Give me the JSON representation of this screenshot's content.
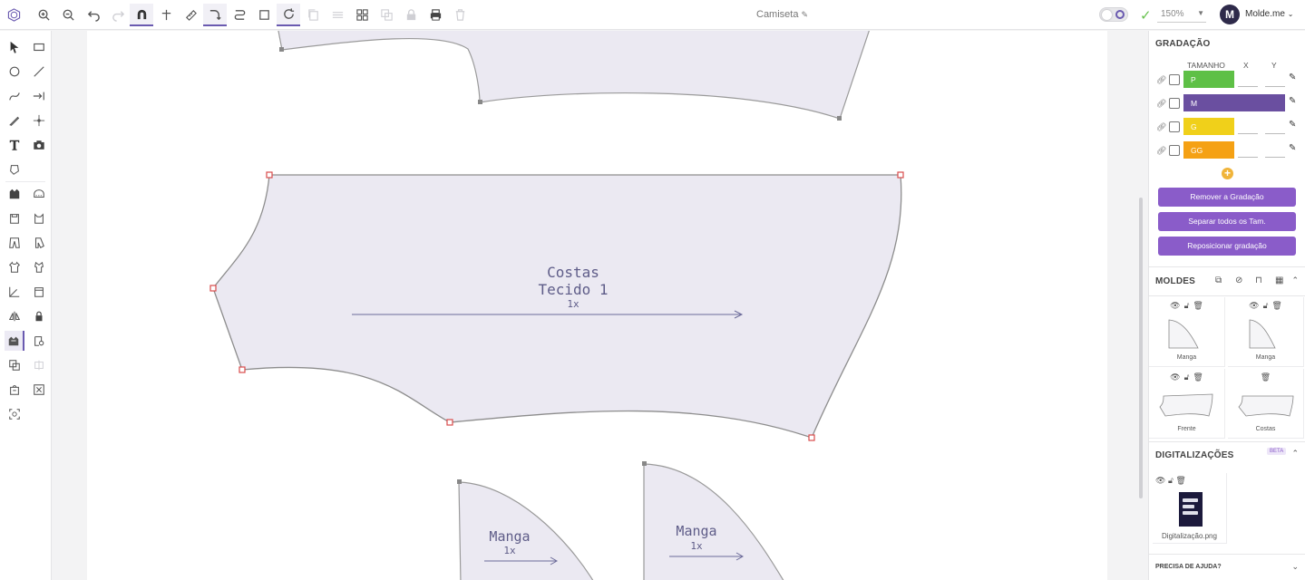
{
  "toolbar": {
    "doc_title": "Camiseta",
    "zoom": "150%",
    "user_initial": "M",
    "user_name": "Molde.me"
  },
  "canvas": {
    "piece_main_name": "Costas",
    "piece_main_fabric": "Tecido 1",
    "piece_main_qty": "1x",
    "manga_label": "Manga",
    "manga_qty": "1x"
  },
  "panel": {
    "grading": {
      "title": "GRADAÇÃO",
      "col_size": "TAMANHO",
      "col_x": "X",
      "col_y": "Y",
      "sizes": [
        {
          "label": "P",
          "color": "#5ec046"
        },
        {
          "label": "M",
          "color": "#6a4fa0"
        },
        {
          "label": "G",
          "color": "#f0d01a"
        },
        {
          "label": "GG",
          "color": "#f5a114"
        }
      ],
      "btn_remove": "Remover a Gradação",
      "btn_separate": "Separar todos os Tam.",
      "btn_reposition": "Reposicionar gradação"
    },
    "molds": {
      "title": "MOLDES",
      "items": [
        "Manga",
        "Manga",
        "Frente",
        "Costas"
      ]
    },
    "scans": {
      "title": "DIGITALIZAÇÕES",
      "badge": "BETA",
      "file": "Digitalização.png"
    },
    "help": "PRECISA DE AJUDA?"
  },
  "colors": {
    "accent": "#8a5cc9",
    "piece_fill": "#ebe9f2"
  }
}
